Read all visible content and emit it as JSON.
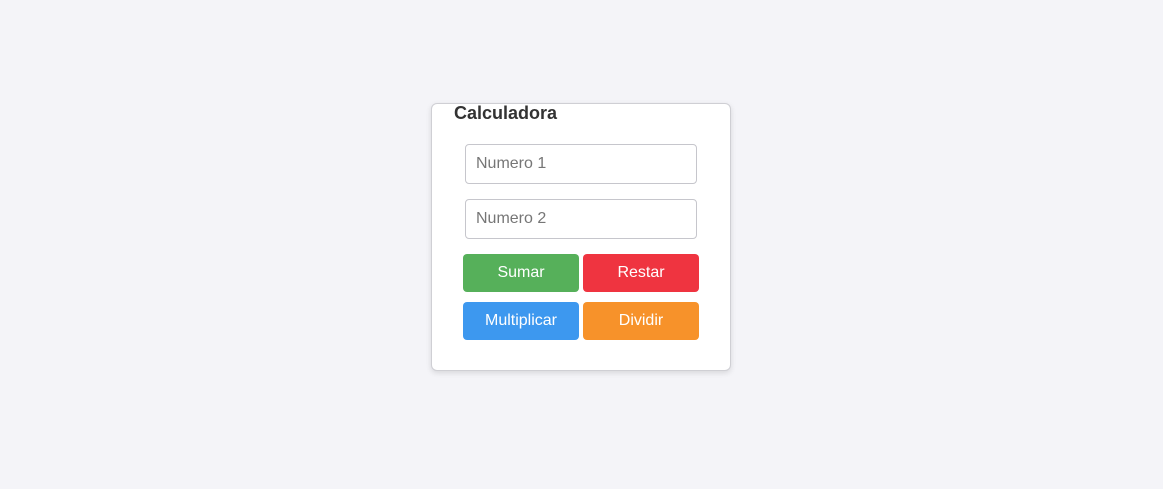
{
  "calculator": {
    "title": "Calculadora",
    "input1": {
      "placeholder": "Numero 1",
      "value": ""
    },
    "input2": {
      "placeholder": "Numero 2",
      "value": ""
    },
    "buttons": {
      "add": {
        "label": "Sumar",
        "color": "#56b05a"
      },
      "subtract": {
        "label": "Restar",
        "color": "#ef3440"
      },
      "multiply": {
        "label": "Multiplicar",
        "color": "#3d98ef"
      },
      "divide": {
        "label": "Dividir",
        "color": "#f7922a"
      }
    }
  }
}
